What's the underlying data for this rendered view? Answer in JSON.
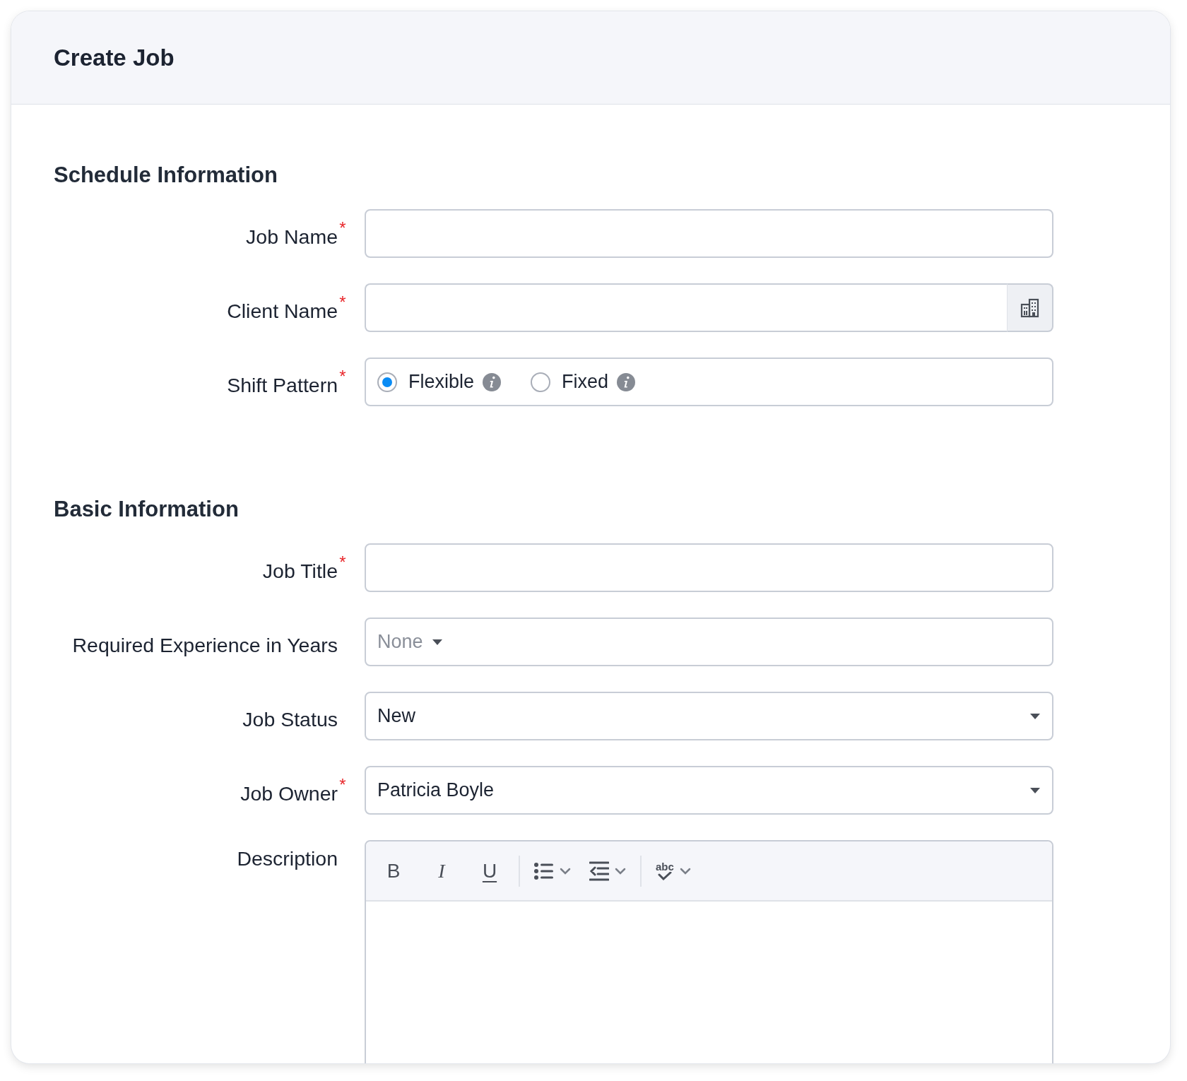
{
  "window": {
    "title": "Create Job"
  },
  "required_mark": "*",
  "sections": [
    {
      "title": "Schedule Information",
      "fields": [
        {
          "kind": "text",
          "label": "Job Name",
          "required": true
        },
        {
          "kind": "lookup",
          "label": "Client Name",
          "required": true
        },
        {
          "kind": "radio",
          "label": "Shift Pattern",
          "required": true,
          "options": [
            {
              "label": "Flexible",
              "selected": true
            },
            {
              "label": "Fixed",
              "selected": false
            }
          ]
        }
      ]
    },
    {
      "title": "Basic Information",
      "fields": [
        {
          "kind": "text",
          "label": "Job Title",
          "required": true
        },
        {
          "kind": "inline-select",
          "label": "Required Experience in Years",
          "required": false,
          "placeholder": "None"
        },
        {
          "kind": "select",
          "label": "Job Status",
          "required": false,
          "value": "New"
        },
        {
          "kind": "select",
          "label": "Job Owner",
          "required": true,
          "value": "Patricia Boyle"
        },
        {
          "kind": "editor",
          "label": "Description",
          "required": false,
          "toolbar": [
            {
              "kind": "bold",
              "label": "B"
            },
            {
              "kind": "italic",
              "label": "I"
            },
            {
              "kind": "underline",
              "label": "U"
            },
            {
              "kind": "separator"
            },
            {
              "kind": "list"
            },
            {
              "kind": "indent"
            },
            {
              "kind": "separator"
            },
            {
              "kind": "spellcheck",
              "label": "abc"
            }
          ]
        }
      ]
    }
  ]
}
